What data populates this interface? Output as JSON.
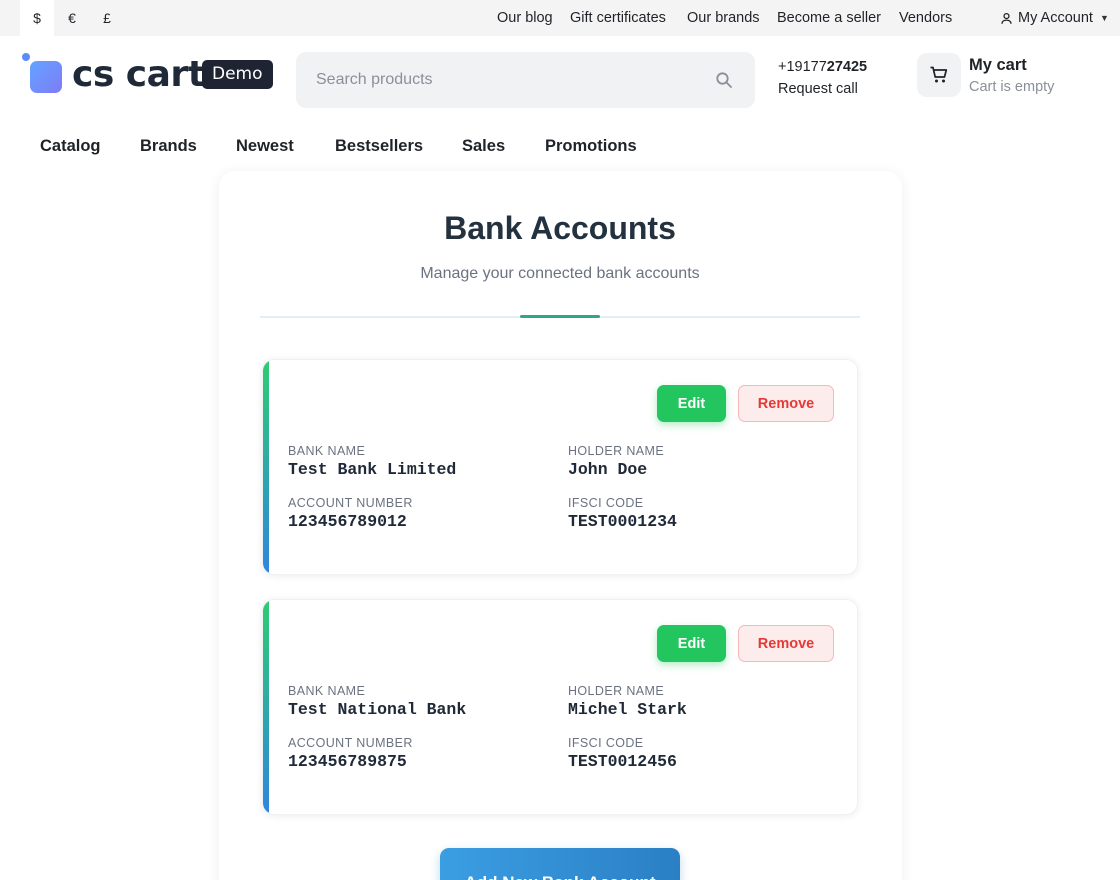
{
  "topbar": {
    "currencies": [
      "$",
      "€",
      "£"
    ],
    "links": [
      "Our blog",
      "Gift certificates",
      "Our brands",
      "Become a seller",
      "Vendors"
    ],
    "account_label": "My Account"
  },
  "header": {
    "logo_text": "cs cart",
    "logo_badge": "Demo",
    "search_placeholder": "Search products",
    "phone_prefix": "+19177",
    "phone_bold": "27425",
    "request_call": "Request call",
    "cart_title": "My cart",
    "cart_subtitle": "Cart is empty"
  },
  "nav": [
    "Catalog",
    "Brands",
    "Newest",
    "Bestsellers",
    "Sales",
    "Promotions"
  ],
  "main": {
    "title": "Bank Accounts",
    "subtitle": "Manage your connected bank accounts",
    "edit_label": "Edit",
    "remove_label": "Remove",
    "labels": {
      "bank_name": "BANK NAME",
      "holder_name": "HOLDER NAME",
      "account_number": "ACCOUNT NUMBER",
      "ifsci_code": "IFSCI CODE"
    },
    "accounts": [
      {
        "bank_name": "Test Bank Limited",
        "holder_name": "John Doe",
        "account_number": "123456789012",
        "ifsci_code": "TEST0001234"
      },
      {
        "bank_name": "Test National Bank",
        "holder_name": "Michel Stark",
        "account_number": "123456789875",
        "ifsci_code": "TEST0012456"
      }
    ],
    "add_button": "Add New Bank Account"
  },
  "colors": {
    "accent_green": "#22c55e",
    "accent_blue": "#2b7fc4",
    "remove_red": "#e53935",
    "divider_accent": "#2ea68a"
  },
  "icons": {
    "search": "search-icon",
    "account": "user-icon",
    "cart": "cart-icon"
  }
}
